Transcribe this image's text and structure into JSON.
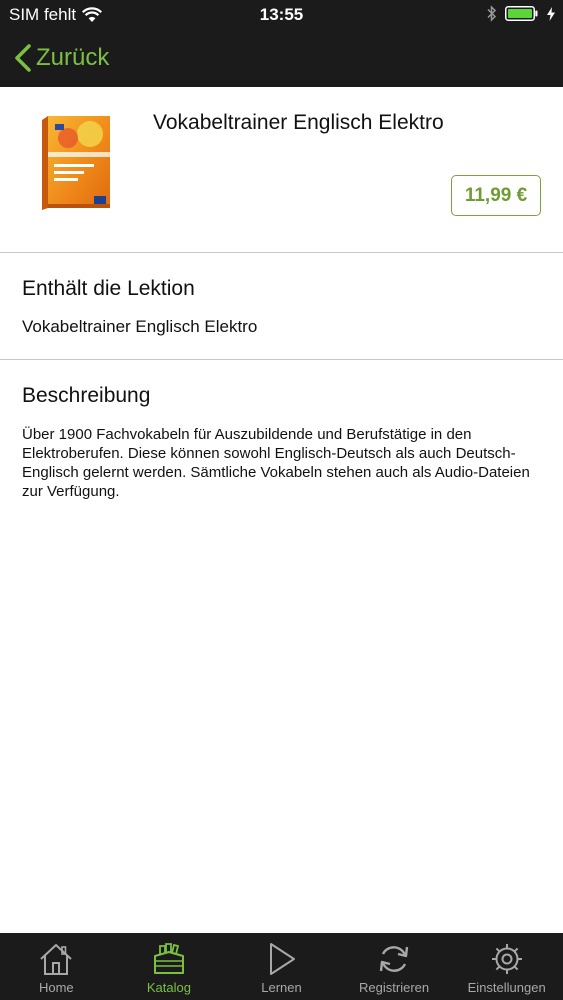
{
  "status_bar": {
    "carrier": "SIM fehlt",
    "time": "13:55"
  },
  "nav": {
    "back_label": "Zurück",
    "accent_color": "#7bc043"
  },
  "product": {
    "title": "Vokabeltrainer Englisch Elektro",
    "price": "11,99 €",
    "cover_image": "book-cover-vokabeltrainer-englisch-elektro"
  },
  "lesson_section": {
    "heading": "Enthält die Lektion",
    "items": [
      "Vokabeltrainer Englisch Elektro"
    ]
  },
  "description_section": {
    "heading": "Beschreibung",
    "text": "Über 1900 Fachvokabeln für Auszubildende und Berufstätige in den Elektroberufen. Diese können sowohl Englisch-Deutsch als auch Deutsch-Englisch gelernt werden. Sämtliche Vokabeln stehen auch als Audio-Dateien zur Verfügung."
  },
  "tabbar": {
    "items": [
      {
        "label": "Home",
        "icon": "home-icon",
        "active": false
      },
      {
        "label": "Katalog",
        "icon": "catalog-icon",
        "active": true
      },
      {
        "label": "Lernen",
        "icon": "play-icon",
        "active": false
      },
      {
        "label": "Registrieren",
        "icon": "refresh-icon",
        "active": false
      },
      {
        "label": "Einstellungen",
        "icon": "gear-icon",
        "active": false
      }
    ]
  }
}
